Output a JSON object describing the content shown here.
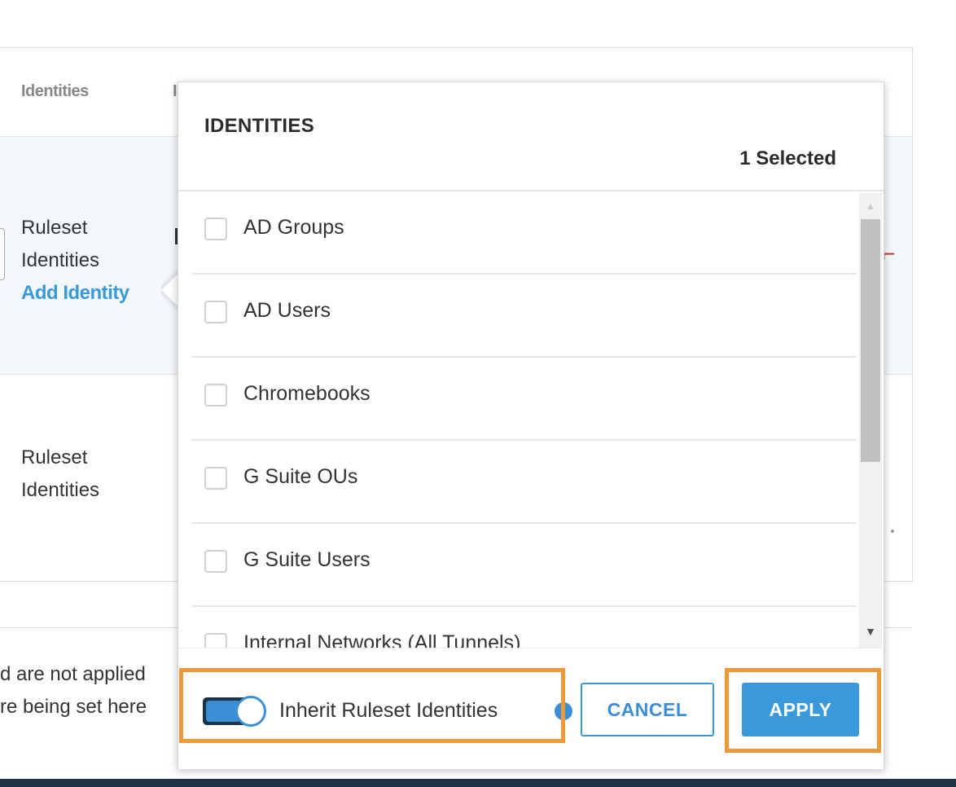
{
  "table": {
    "header": {
      "identities": "Identities",
      "next_col": "I"
    },
    "row1": {
      "line1": "Ruleset",
      "line2": "Identities",
      "add_identity": "Add Identity"
    },
    "row2": {
      "line1": "Ruleset",
      "line2": "Identities"
    },
    "footer": {
      "line1": "d are not applied",
      "line2": "re being set here"
    }
  },
  "popup": {
    "title": "IDENTITIES",
    "selected_count": "1 Selected",
    "items": [
      {
        "label": "AD Groups",
        "checked": false
      },
      {
        "label": "AD Users",
        "checked": false
      },
      {
        "label": "Chromebooks",
        "checked": false
      },
      {
        "label": "G Suite OUs",
        "checked": false
      },
      {
        "label": "G Suite Users",
        "checked": false
      },
      {
        "label": "Internal Networks (All Tunnels)",
        "checked": false
      }
    ],
    "inherit_toggle": {
      "label": "Inherit Ruleset Identities",
      "on": true,
      "info_glyph": "i"
    },
    "cancel_label": "CANCEL",
    "apply_label": "APPLY"
  },
  "colors": {
    "accent": "#3a9ad9",
    "highlight": "#ef9a3a",
    "dark_bar": "#1e3446"
  }
}
